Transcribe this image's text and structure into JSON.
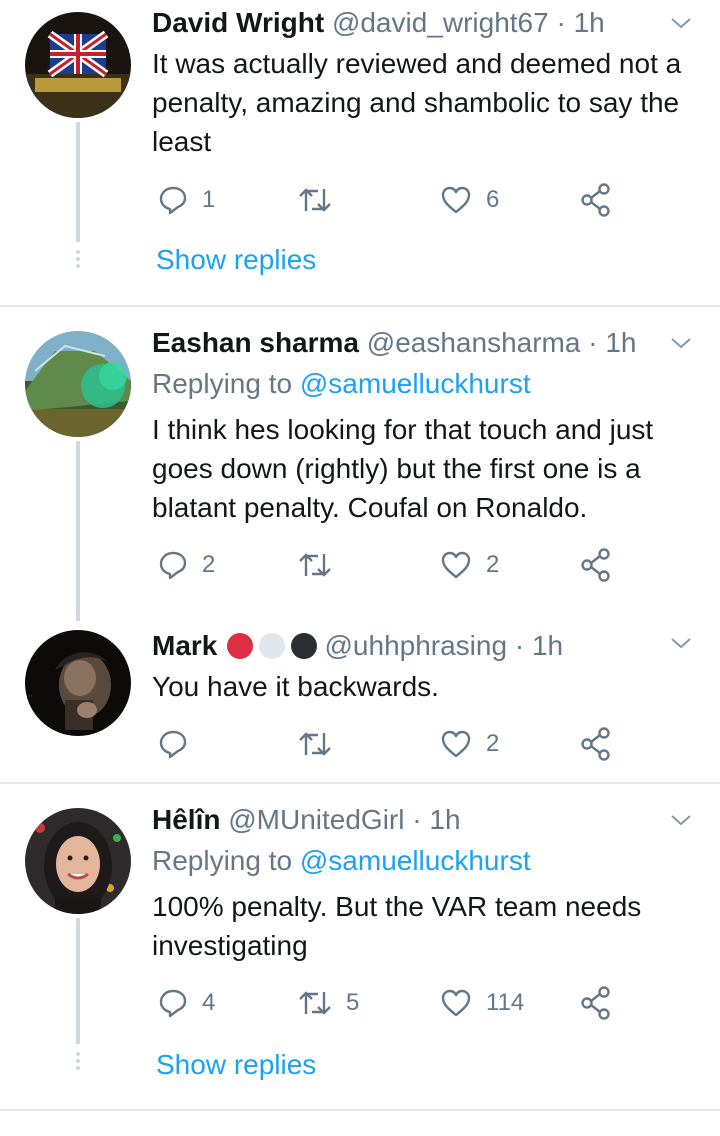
{
  "colors": {
    "accent": "#1da1f2",
    "muted": "#657786",
    "text": "#14171a",
    "divider": "#e6ecf0"
  },
  "tweets": [
    {
      "name": "David Wright",
      "handle": "@david_wright67",
      "sep": "·",
      "time": "1h",
      "replying_label": "",
      "replying_to": "",
      "text": "It was actually reviewed and deemed not a penalty, amazing and shambolic to say the least",
      "reply_count": "1",
      "retweet_count": "",
      "like_count": "6",
      "show_replies": "Show replies"
    },
    {
      "name": "Eashan sharma",
      "handle": "@eashansharma",
      "sep": "·",
      "time": "1h",
      "replying_label": "Replying to ",
      "replying_to": "@samuelluckhurst",
      "text": "I think hes looking for that touch and just goes down (rightly) but the first one is a blatant penalty. Coufal on Ronaldo.",
      "reply_count": "2",
      "retweet_count": "",
      "like_count": "2"
    },
    {
      "name": "Mark",
      "badges": [
        "red-circle",
        "white-circle",
        "black-circle"
      ],
      "handle": "@uhhphrasing",
      "sep": "·",
      "time": "1h",
      "text": "You have it backwards.",
      "reply_count": "",
      "retweet_count": "",
      "like_count": "2"
    },
    {
      "name": "Hêlîn",
      "handle": "@MUnitedGirl",
      "sep": "·",
      "time": "1h",
      "replying_label": "Replying to ",
      "replying_to": "@samuelluckhurst",
      "text": "100% penalty. But the VAR team needs investigating",
      "reply_count": "4",
      "retweet_count": "5",
      "like_count": "114",
      "show_replies": "Show replies"
    }
  ]
}
